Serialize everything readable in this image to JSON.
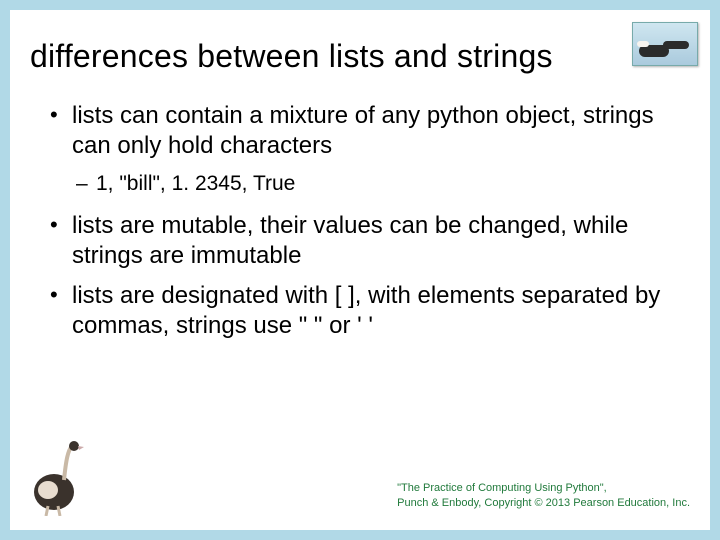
{
  "title": "differences between lists and strings",
  "bullets": {
    "b1": "lists can contain a mixture of any python object, strings can only hold characters",
    "b1sub": "1, \"bill\", 1. 2345, True",
    "b2": "lists are mutable, their values can be changed, while strings are immutable",
    "b3": "lists are designated with [ ], with elements separated by commas, strings use \" \" or ' '"
  },
  "footer": {
    "line1": "\"The Practice of Computing Using Python\",",
    "line2": "Punch & Enbody, Copyright © 2013 Pearson Education, Inc."
  }
}
